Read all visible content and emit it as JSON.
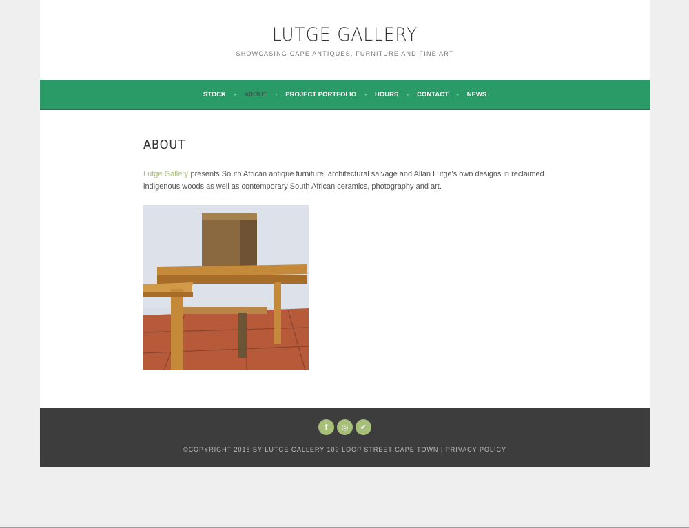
{
  "header": {
    "title": "LUTGE GALLERY",
    "tagline": "SHOWCASING CAPE ANTIQUES, FURNITURE AND FINE ART"
  },
  "nav": {
    "items": [
      {
        "label": "STOCK"
      },
      {
        "label": "ABOUT"
      },
      {
        "label": "PROJECT PORTFOLIO"
      },
      {
        "label": "HOURS"
      },
      {
        "label": "CONTACT"
      },
      {
        "label": "NEWS"
      }
    ],
    "active": "ABOUT",
    "separator": "•"
  },
  "main": {
    "title": "ABOUT",
    "intro_link": "Lutge Gallery",
    "intro_text": " presents South African antique furniture, architectural salvage and Allan Lutge's own designs in reclaimed indigenous woods as well as contemporary South African ceramics, photography and art."
  },
  "footer": {
    "social": [
      {
        "icon": "facebook-icon",
        "glyph": "f"
      },
      {
        "icon": "instagram-icon",
        "glyph": "◎"
      },
      {
        "icon": "twitter-icon",
        "glyph": "✔"
      }
    ],
    "copyright": "©COPYRIGHT 2018 BY LUTGE GALLERY 109 LOOP STREET CAPE TOWN",
    "divider": " | ",
    "privacy": "PRIVACY POLICY"
  },
  "colors": {
    "nav_bg": "#2a9a66",
    "link": "#a8bf7a",
    "footer_bg": "#3d3d3d"
  }
}
